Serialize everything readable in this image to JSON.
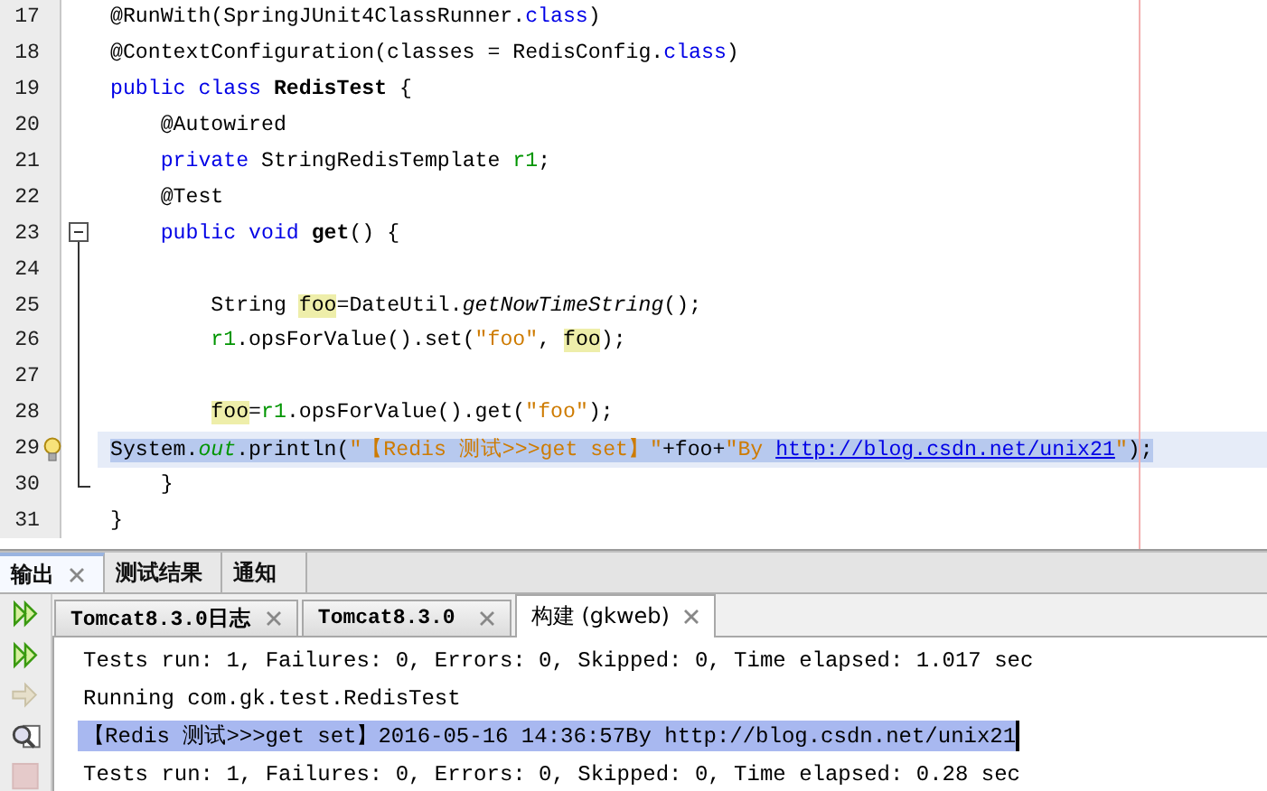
{
  "editor": {
    "lines": [
      {
        "number": "17",
        "current": false,
        "selected": false,
        "hint": false,
        "tokens": [
          {
            "t": "@RunWith(SpringJUnit4ClassRunner.",
            "kind": "plain"
          },
          {
            "t": "class",
            "kind": "keyword"
          },
          {
            "t": ")",
            "kind": "plain"
          }
        ]
      },
      {
        "number": "18",
        "current": false,
        "selected": false,
        "hint": false,
        "tokens": [
          {
            "t": "@ContextConfiguration(classes = RedisConfig.",
            "kind": "plain"
          },
          {
            "t": "class",
            "kind": "keyword"
          },
          {
            "t": ")",
            "kind": "plain"
          }
        ]
      },
      {
        "number": "19",
        "current": false,
        "selected": false,
        "hint": false,
        "tokens": [
          {
            "t": "public class ",
            "kind": "keyword"
          },
          {
            "t": "RedisTest",
            "kind": "bold"
          },
          {
            "t": " {",
            "kind": "plain"
          }
        ]
      },
      {
        "number": "20",
        "current": false,
        "selected": false,
        "hint": false,
        "tokens": [
          {
            "t": "    @Autowired",
            "kind": "plain"
          }
        ]
      },
      {
        "number": "21",
        "current": false,
        "selected": false,
        "hint": false,
        "tokens": [
          {
            "t": "    private ",
            "kind": "keyword"
          },
          {
            "t": "StringRedisTemplate ",
            "kind": "plain"
          },
          {
            "t": "r1",
            "kind": "field"
          },
          {
            "t": ";",
            "kind": "plain"
          }
        ]
      },
      {
        "number": "22",
        "current": false,
        "selected": false,
        "hint": false,
        "tokens": [
          {
            "t": "    @Test",
            "kind": "plain"
          }
        ]
      },
      {
        "number": "23",
        "current": false,
        "selected": false,
        "hint": false,
        "fold": {
          "expanded": true
        },
        "tokens": [
          {
            "t": "    public void ",
            "kind": "keyword"
          },
          {
            "t": "get",
            "kind": "bold"
          },
          {
            "t": "() {",
            "kind": "plain"
          }
        ]
      },
      {
        "number": "24",
        "current": false,
        "selected": false,
        "hint": false
      },
      {
        "number": "25",
        "current": false,
        "selected": false,
        "hint": false,
        "tokens": [
          {
            "t": "        String ",
            "kind": "plain"
          },
          {
            "t": "foo",
            "kind": "mark"
          },
          {
            "t": "=DateUtil.",
            "kind": "plain"
          },
          {
            "t": "getNowTimeString",
            "kind": "italic"
          },
          {
            "t": "();",
            "kind": "plain"
          }
        ]
      },
      {
        "number": "26",
        "current": false,
        "selected": false,
        "hint": false,
        "tokens": [
          {
            "t": "        r1",
            "kind": "field"
          },
          {
            "t": ".opsForValue().set(",
            "kind": "plain"
          },
          {
            "t": "\"foo\"",
            "kind": "string"
          },
          {
            "t": ", ",
            "kind": "plain"
          },
          {
            "t": "foo",
            "kind": "mark"
          },
          {
            "t": ");",
            "kind": "plain"
          }
        ]
      },
      {
        "number": "27",
        "current": false,
        "selected": false,
        "hint": false
      },
      {
        "number": "28",
        "current": false,
        "selected": false,
        "hint": false,
        "tokens": [
          {
            "t": "        foo",
            "kind": "mark"
          },
          {
            "t": "=",
            "kind": "plain"
          },
          {
            "t": "r1",
            "kind": "field"
          },
          {
            "t": ".opsForValue().get(",
            "kind": "plain"
          },
          {
            "t": "\"foo\"",
            "kind": "string"
          },
          {
            "t": ");",
            "kind": "plain"
          }
        ]
      },
      {
        "number": "29",
        "current": true,
        "selected": true,
        "hint": true,
        "tokens": [
          {
            "t": "System.",
            "kind": "plain"
          },
          {
            "t": "out",
            "kind": "static"
          },
          {
            "t": ".println(",
            "kind": "plain"
          },
          {
            "t": "\"【Redis 测试>>>get set】\"",
            "kind": "string"
          },
          {
            "t": "+foo+",
            "kind": "plain"
          },
          {
            "t": "\"By ",
            "kind": "string"
          },
          {
            "t": "http://blog.csdn.net/unix21",
            "kind": "link"
          },
          {
            "t": "\"",
            "kind": "string"
          },
          {
            "t": ");",
            "kind": "plain"
          }
        ]
      },
      {
        "number": "30",
        "current": false,
        "selected": false,
        "hint": false,
        "fold_end": true,
        "tokens": [
          {
            "t": "    }",
            "kind": "plain"
          }
        ]
      },
      {
        "number": "31",
        "current": false,
        "selected": false,
        "hint": false,
        "tokens": [
          {
            "t": "}",
            "kind": "plain"
          }
        ]
      }
    ]
  },
  "panel_tabs": [
    {
      "label": "输出",
      "selected": true,
      "closable": true
    },
    {
      "label": "测试结果",
      "selected": false,
      "closable": false
    },
    {
      "label": "通知",
      "selected": false,
      "closable": false
    }
  ],
  "toolbar": [
    {
      "kind": "rerun",
      "disabled": false
    },
    {
      "kind": "rerun-failed",
      "disabled": false
    },
    {
      "kind": "next",
      "disabled": true
    },
    {
      "kind": "find",
      "disabled": false
    },
    {
      "kind": "stop",
      "disabled": true
    }
  ],
  "output_tabs": [
    {
      "label": "Tomcat8.3.0日志",
      "selected": false
    },
    {
      "label": "Tomcat8.3.0",
      "selected": false
    },
    {
      "label": "构建 (gkweb)",
      "selected": true
    }
  ],
  "output_lines": [
    {
      "text": "Tests run: 1, Failures: 0, Errors: 0, Skipped: 0, Time elapsed: 1.017 sec",
      "selected": false
    },
    {
      "text": "Running com.gk.test.RedisTest",
      "selected": false
    },
    {
      "text": "【Redis 测试>>>get set】2016-05-16 14:36:57By http://blog.csdn.net/unix21",
      "selected": true
    },
    {
      "text": "Tests run: 1, Failures: 0, Errors: 0, Skipped: 0, Time elapsed: 0.28 sec",
      "selected": false
    }
  ]
}
